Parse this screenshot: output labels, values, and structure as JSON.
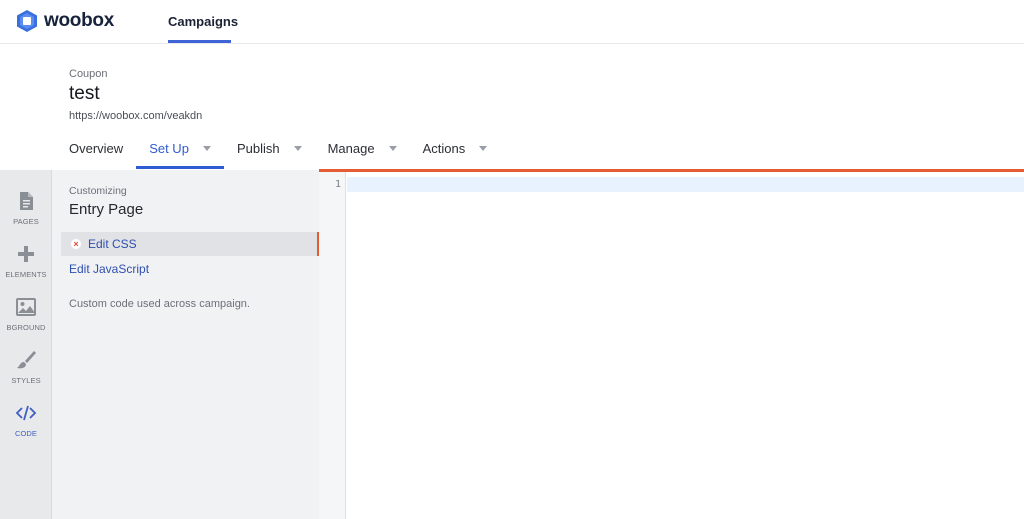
{
  "app": {
    "brand": "woobox"
  },
  "top_nav": {
    "campaigns_label": "Campaigns"
  },
  "campaign": {
    "type": "Coupon",
    "title": "test",
    "url": "https://woobox.com/veakdn"
  },
  "tabs": [
    {
      "label": "Overview",
      "has_menu": false,
      "active": false
    },
    {
      "label": "Set Up",
      "has_menu": true,
      "active": true
    },
    {
      "label": "Publish",
      "has_menu": true,
      "active": false
    },
    {
      "label": "Manage",
      "has_menu": true,
      "active": false
    },
    {
      "label": "Actions",
      "has_menu": true,
      "active": false
    }
  ],
  "rail": [
    {
      "label": "PAGES",
      "icon": "page-icon"
    },
    {
      "label": "ELEMENTS",
      "icon": "plus-icon"
    },
    {
      "label": "BGROUND",
      "icon": "image-icon"
    },
    {
      "label": "STYLES",
      "icon": "brush-icon"
    },
    {
      "label": "CODE",
      "icon": "code-icon",
      "active": true
    }
  ],
  "panel": {
    "subtitle": "Customizing",
    "title": "Entry Page",
    "items": [
      {
        "label": "Edit CSS",
        "active": true,
        "status_icon": "error-x-icon"
      },
      {
        "label": "Edit JavaScript",
        "active": false
      }
    ],
    "help_text": "Custom code used across campaign."
  },
  "editor": {
    "line_numbers": [
      "1"
    ]
  },
  "colors": {
    "accent_blue": "#2f5bd3",
    "accent_orange": "#e45b34",
    "brand_dark": "#17223b"
  }
}
